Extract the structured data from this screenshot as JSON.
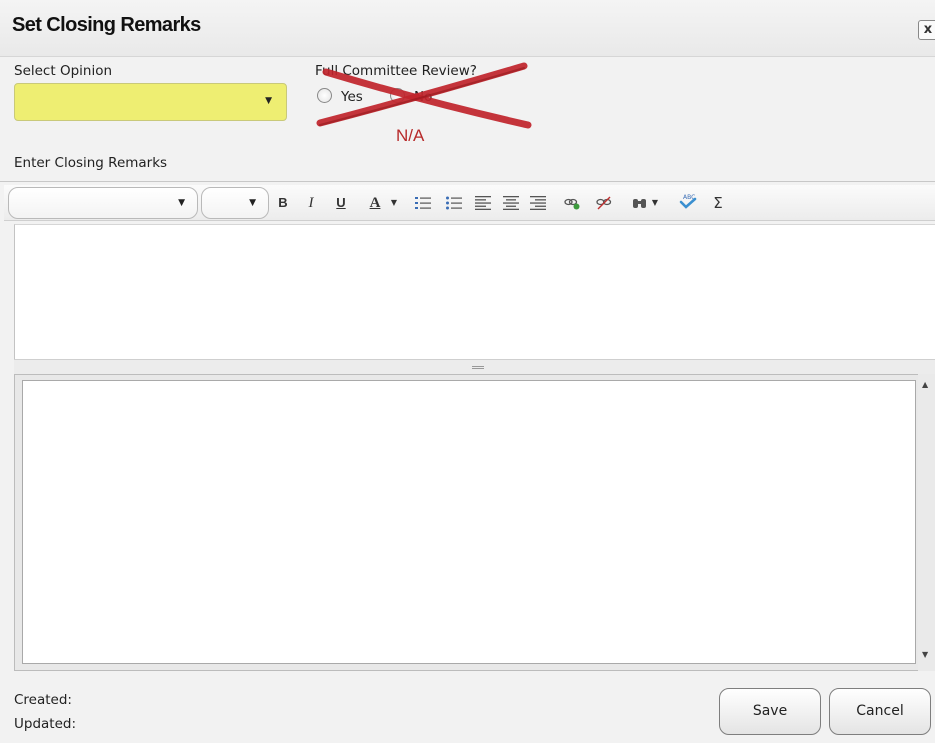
{
  "dialog": {
    "title": "Set Closing Remarks",
    "close_label": "x"
  },
  "opinion": {
    "label": "Select Opinion",
    "selected_value": ""
  },
  "committee_review": {
    "label": "Full Committee Review?",
    "option_yes": "Yes",
    "option_no": "No",
    "annotation": "N/A"
  },
  "remarks": {
    "label": "Enter Closing Remarks",
    "text": "",
    "history_text": ""
  },
  "toolbar": {
    "font_name": "",
    "font_size": "",
    "bold": "B",
    "italic": "I",
    "underline": "U",
    "font_color": "A",
    "symbol": "Σ"
  },
  "footer": {
    "created_label": "Created:",
    "updated_label": "Updated:",
    "save_label": "Save",
    "cancel_label": "Cancel"
  },
  "colors": {
    "select_fill": "#eeee72",
    "cross_red": "#c0242b",
    "annotation_red": "#b72a2a"
  }
}
